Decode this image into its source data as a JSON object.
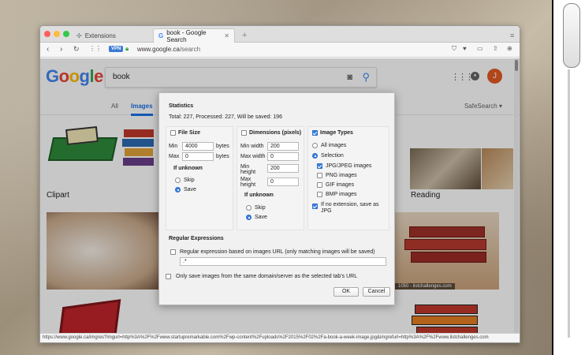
{
  "browser": {
    "tabs": [
      {
        "label": "Extensions",
        "icon": "puzzle-icon"
      },
      {
        "label": "book - Google Search",
        "icon": "google-g-icon"
      }
    ],
    "new_tab_label": "+",
    "url_host": "www.google.ca",
    "url_path": "/search",
    "vpn_label": "VPN"
  },
  "google": {
    "logo": [
      "G",
      "o",
      "o",
      "g",
      "l",
      "e"
    ],
    "logo_colors": [
      "#4285f4",
      "#ea4335",
      "#fbbc05",
      "#4285f4",
      "#34a853",
      "#ea4335"
    ],
    "query": "book",
    "avatar_letter": "J",
    "tabs": [
      "All",
      "Images"
    ],
    "safesearch": "SafeSearch ▾",
    "thumb_labels": {
      "clipart": "Clipart",
      "reading": "Reading"
    },
    "captions": {
      "listchallenges": "1050 - listchallenges.com"
    }
  },
  "status_url": "https://www.google.ca/imgres?imgurl=http%3A%2F%2Fwww.startupremarkable.com%2Fwp-content%2Fuploads%2F2015%2F02%2Fa-book-a-week-image.jpg&imgrefurl=http%3A%2F%2Fwww.listchallenges.com",
  "dialog": {
    "statistics_title": "Statistics",
    "statistics_text": "Total: 227, Processed: 227, Will be saved: 196",
    "file_size": {
      "title": "File Size",
      "min_label": "Min",
      "min_value": "4000",
      "min_unit": "bytes",
      "max_label": "Max",
      "max_value": "0",
      "max_unit": "bytes",
      "if_unknown": "If unknown",
      "skip": "Skip",
      "save": "Save"
    },
    "dimensions": {
      "title": "Dimensions (pixels)",
      "min_width_label": "Min width",
      "min_width": "200",
      "max_width_label": "Max width",
      "max_width": "0",
      "min_height_label": "Min height",
      "min_height": "200",
      "max_height_label": "Max height",
      "max_height": "0",
      "if_unknown": "If unknown",
      "skip": "Skip",
      "save": "Save"
    },
    "image_types": {
      "title": "Image Types",
      "all_images": "All images",
      "selection": "Selection",
      "jpg": "JPG/JPEG images",
      "png": "PNG images",
      "gif": "GIF images",
      "bmp": "BMP images",
      "no_ext_line1": "If no extension, save as",
      "no_ext_line2": "JPG"
    },
    "regex": {
      "title": "Regular Expressions",
      "checkbox_label": "Regular expression based on images URL (only matching images will be saved)",
      "value": ".*"
    },
    "same_domain": "Only save images from the same domain/server as the selected tab's URL",
    "ok": "OK",
    "cancel": "Cancel"
  }
}
